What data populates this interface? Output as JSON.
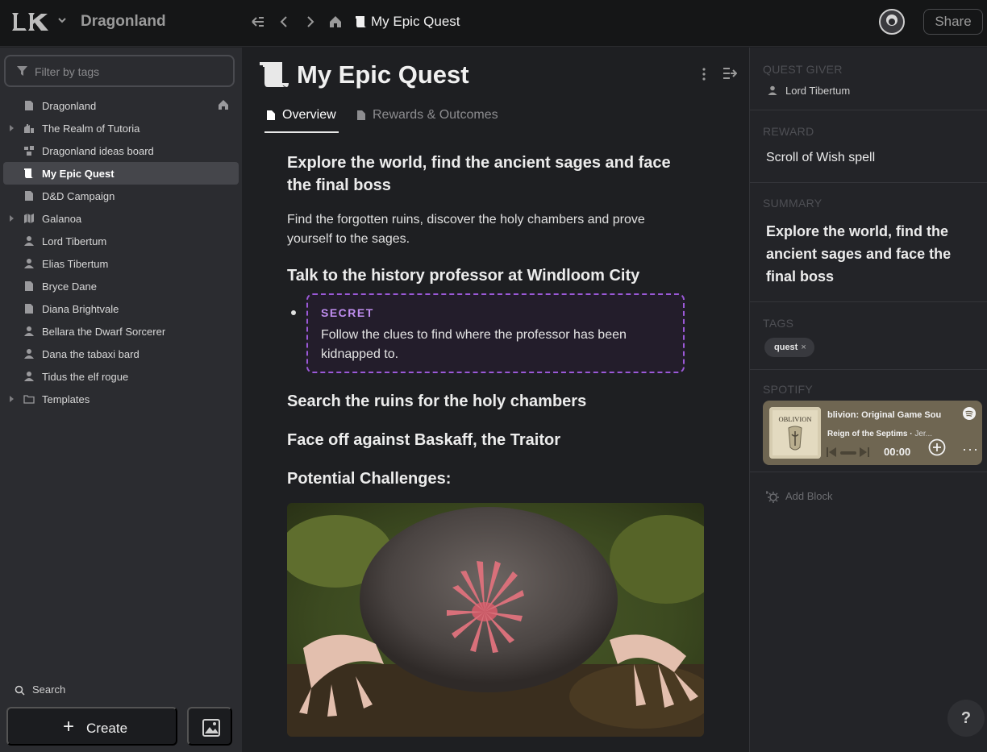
{
  "topbar": {
    "workspace": "Dragonland",
    "breadcrumb": "My Epic Quest",
    "share_label": "Share"
  },
  "sidebar": {
    "filter_placeholder": "Filter by tags",
    "items": [
      {
        "label": "Dragonland",
        "icon": "page-icon",
        "caret": false,
        "home": true
      },
      {
        "label": "The Realm of Tutoria",
        "icon": "buildings-icon",
        "caret": true
      },
      {
        "label": "Dragonland ideas board",
        "icon": "board-icon",
        "caret": false
      },
      {
        "label": "My Epic Quest",
        "icon": "scroll-icon",
        "caret": false,
        "active": true
      },
      {
        "label": "D&D Campaign",
        "icon": "page-icon",
        "caret": false
      },
      {
        "label": "Galanoa",
        "icon": "map-icon",
        "caret": true
      },
      {
        "label": "Lord Tibertum",
        "icon": "person-icon",
        "caret": false
      },
      {
        "label": "Elias Tibertum",
        "icon": "person-icon",
        "caret": false
      },
      {
        "label": "Bryce Dane",
        "icon": "page-icon",
        "caret": false
      },
      {
        "label": "Diana Brightvale",
        "icon": "page-icon",
        "caret": false
      },
      {
        "label": "Bellara the Dwarf Sorcerer",
        "icon": "person-icon",
        "caret": false
      },
      {
        "label": "Dana the tabaxi bard",
        "icon": "person-icon",
        "caret": false
      },
      {
        "label": "Tidus the elf rogue",
        "icon": "person-icon",
        "caret": false
      },
      {
        "label": "Templates",
        "icon": "folder-icon",
        "caret": true
      }
    ],
    "search_label": "Search",
    "create_label": "Create"
  },
  "main": {
    "title": "My Epic Quest",
    "tabs": [
      {
        "label": "Overview",
        "active": true
      },
      {
        "label": "Rewards & Outcomes",
        "active": false
      }
    ],
    "heading1": "Explore the world, find the ancient sages and face the final boss",
    "paragraph1": "Find the forgotten ruins, discover the holy chambers and prove yourself to the sages.",
    "heading2": "Talk to the history professor at Windloom City",
    "secret_title": "SECRET",
    "secret_body": "Follow the clues to find where the professor has been kidnapped to.",
    "heading3": "Search the ruins for the holy chambers",
    "heading4": "Face off against Baskaff, the Traitor",
    "heading5": "Potential Challenges:"
  },
  "right_panel": {
    "quest_giver_label": "QUEST GIVER",
    "quest_giver": "Lord Tibertum",
    "reward_label": "REWARD",
    "reward": "Scroll of Wish spell",
    "summary_label": "SUMMARY",
    "summary": "Explore the world, find the ancient sages and face the final boss",
    "tags_label": "TAGS",
    "tags": [
      "quest"
    ],
    "spotify_label": "SPOTIFY",
    "spotify": {
      "album": "blivion: Original Game Sou",
      "track": "Reign of the Septims",
      "artist": "Jer...",
      "time": "00:00",
      "cover_text": "OBLIVION"
    },
    "add_block_label": "Add Block"
  },
  "help_label": "?",
  "colors": {
    "accent_secret": "#9b59d8",
    "secret_title": "#c08ef0",
    "active_item_bg": "#45464b"
  }
}
